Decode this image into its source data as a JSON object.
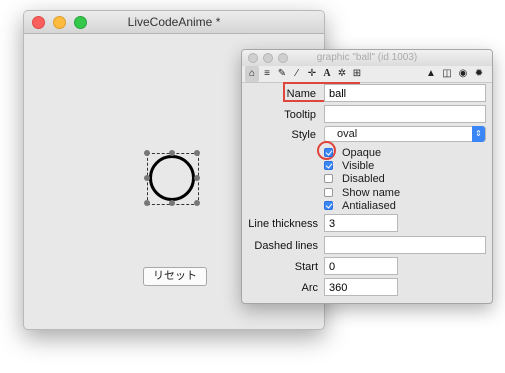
{
  "main_window": {
    "title": "LiveCodeAnime *",
    "reset_button": "リセット"
  },
  "inspector": {
    "title": "graphic \"ball\" (id 1003)",
    "toolbar_icons": [
      "home-icon",
      "database-icon",
      "pencil-icon",
      "wand-icon",
      "move-icon",
      "text-icon",
      "gears-icon",
      "grid-icon",
      "lock-icon",
      "resize-icon",
      "target-icon",
      "gear-icon"
    ],
    "name_label": "Name",
    "name_value": "ball",
    "tooltip_label": "Tooltip",
    "tooltip_value": "",
    "style_label": "Style",
    "style_value": "oval",
    "checkboxes": [
      {
        "label": "Opaque",
        "checked": true
      },
      {
        "label": "Visible",
        "checked": true
      },
      {
        "label": "Disabled",
        "checked": false
      },
      {
        "label": "Show name",
        "checked": false
      },
      {
        "label": "Antialiased",
        "checked": true
      }
    ],
    "line_thickness_label": "Line thickness",
    "line_thickness_value": "3",
    "dashed_lines_label": "Dashed lines",
    "dashed_lines_value": "",
    "start_label": "Start",
    "start_value": "0",
    "arc_label": "Arc",
    "arc_value": "360"
  },
  "colors": {
    "highlight": "#e0453c",
    "accent": "#3b86f7"
  }
}
